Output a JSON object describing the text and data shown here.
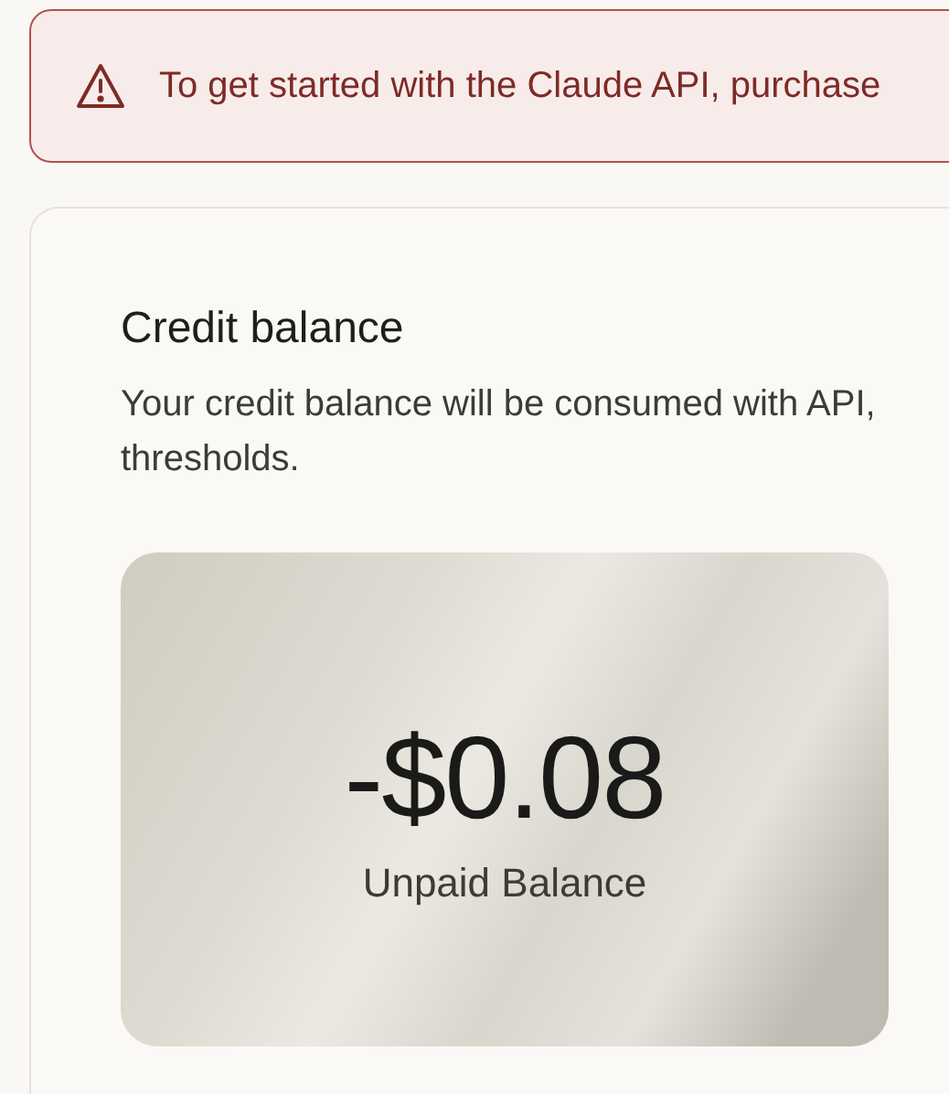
{
  "alert": {
    "text": "To get started with the Claude API, purchase"
  },
  "credit": {
    "title": "Credit balance",
    "description": "Your credit balance will be consumed with API,\nthresholds.",
    "balance": {
      "amount": "-$0.08",
      "label": "Unpaid Balance"
    }
  }
}
